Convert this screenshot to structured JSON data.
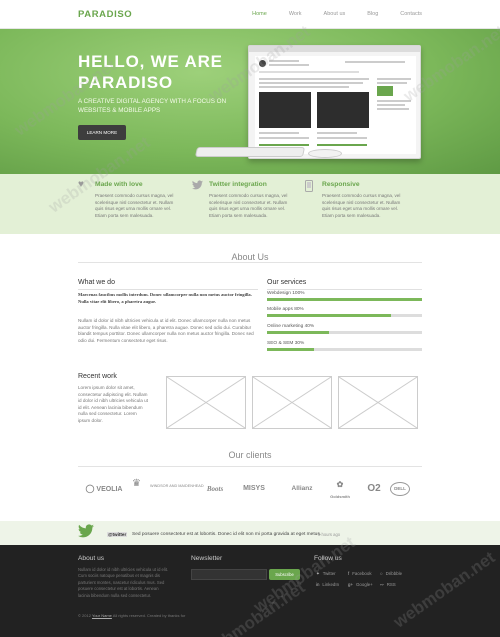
{
  "header": {
    "logo": "PARADISO",
    "nav": [
      "Home",
      "Work",
      "About us",
      "Blog",
      "Contacts"
    ]
  },
  "hero": {
    "title_line1": "HELLO, WE ARE",
    "title_line2": "PARADISO",
    "subtitle": "A CREATIVE DIGITAL AGENCY WITH A FOCUS ON WEBSITES & MOBILE APPS",
    "button": "LEARN MORE"
  },
  "features": [
    {
      "title": "Made with love",
      "text": "Praesent commodo cursus magna, vel scelerisque nisl consectetur et. Nullam quis risus eget urna mollis ornare vel. Etiam porta sem malesuada."
    },
    {
      "title": "Twitter integration",
      "text": "Praesent commodo cursus magna, vel scelerisque nisl consectetur et. Nullam quis risus eget urna mollis ornare vel. Etiam porta sem malesuada."
    },
    {
      "title": "Responsive",
      "text": "Praesent commodo cursus magna, vel scelerisque nisl consectetur et. Nullam quis risus eget urna mollis ornare vel. Etiam porta sem malesuada."
    }
  ],
  "about": {
    "title": "About Us",
    "what_we_do": {
      "heading": "What we do",
      "lead": "Maecenas faucibus mollis interdum. Donec ullamcorper nulla non metus auctor fringilla. Nulla vitae elit libero, a pharetra augue.",
      "body": "Nullam id dolor id nibh ultricies vehicula ut id elit. Donec ullamcorper nulla non metus auctor fringilla. Nulla vitae elit libero, a pharetra augue. Donec sed odio dui. Curabitur blandit tempus porttitor. Donec ullamcorper nulla non metus auctor fringilla. Donec sed odio dui. Fermentum consectetur eget risus."
    },
    "services": {
      "heading": "Our services",
      "items": [
        {
          "label": "Webdesign 100%",
          "value": 100
        },
        {
          "label": "Mobile apps 80%",
          "value": 80
        },
        {
          "label": "Online marketing 40%",
          "value": 40
        },
        {
          "label": "SEO & SEM 30%",
          "value": 30
        }
      ]
    }
  },
  "recent_work": {
    "heading": "Recent work",
    "text": "Lorem ipsum dolor sit amet, consectetur adipiscing elit. Nullam id dolor id nibh ultricies vehicula ut id elit. Aenean lacinia bibendum nulla sed consectetur. Lorem ipsum dolor."
  },
  "clients": {
    "title": "Our clients",
    "logos": [
      "VEOLIA",
      "WINDSOR AND MAIDENHEAD",
      "Boots",
      "MISYS",
      "Allianz",
      "Goldsmith",
      "O2",
      "DELL"
    ]
  },
  "tweet": {
    "handle": "@twitter",
    "text": "Sed posuere consectetur est at lobortis. Donec id elit non mi porta gravida at eget metus.",
    "time": "8 hours ago"
  },
  "footer": {
    "about": {
      "heading": "About us",
      "text": "Nullam id dolor id nibh ultricies vehicula ut id elit. Cum sociis natoque penatibus et magnis dis parturient montes, nascetur ridiculus mus. Sed posuere consectetur est at lobortis. Aenean lacinia bibendum nulla sed consectetur."
    },
    "newsletter": {
      "heading": "Newsletter",
      "placeholder": "",
      "button": "Subscribe"
    },
    "follow": {
      "heading": "Follow us",
      "links": [
        "Twitter",
        "Facebook",
        "Dribbble",
        "LinkedIn",
        "Google+",
        "RSS"
      ]
    },
    "copyright_prefix": "© 2012",
    "copyright_name": "Your Name",
    "copyright_mid": "All rights reserved. Created by",
    "copyright_tail": "thanks for"
  },
  "watermark": "webmoban.net",
  "colors": {
    "accent": "#6aa64d",
    "hero": "#7cb85a",
    "feature_band": "#e3f0d6",
    "footer": "#222222"
  }
}
